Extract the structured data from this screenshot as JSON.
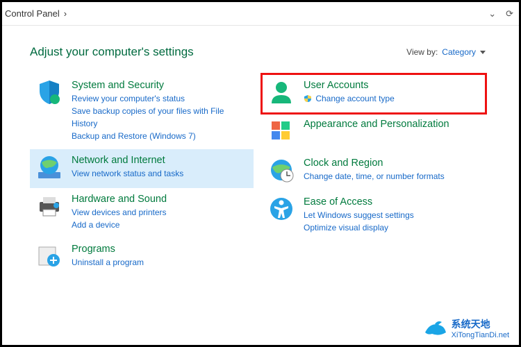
{
  "breadcrumb": {
    "root": "Control Panel",
    "sep": "›"
  },
  "toolbar": {
    "dropdown_icon": "⌄",
    "refresh_icon": "⟳"
  },
  "headline": "Adjust your computer's settings",
  "viewby": {
    "label": "View by:",
    "mode": "Category",
    "caret": "▾"
  },
  "left": [
    {
      "title": "System and Security",
      "subs": [
        "Review your computer's status",
        "Save backup copies of your files with File History",
        "Backup and Restore (Windows 7)"
      ]
    },
    {
      "title": "Network and Internet",
      "subs": [
        "View network status and tasks"
      ]
    },
    {
      "title": "Hardware and Sound",
      "subs": [
        "View devices and printers",
        "Add a device"
      ]
    },
    {
      "title": "Programs",
      "subs": [
        "Uninstall a program"
      ]
    }
  ],
  "right": [
    {
      "title": "User Accounts",
      "subs": [
        "Change account type"
      ],
      "shield": true
    },
    {
      "title": "Appearance and Personalization",
      "subs": []
    },
    {
      "title": "Clock and Region",
      "subs": [
        "Change date, time, or number formats"
      ]
    },
    {
      "title": "Ease of Access",
      "subs": [
        "Let Windows suggest settings",
        "Optimize visual display"
      ]
    }
  ],
  "watermark": {
    "cn": "系统天地",
    "url": "XiTongTianDi.net"
  }
}
